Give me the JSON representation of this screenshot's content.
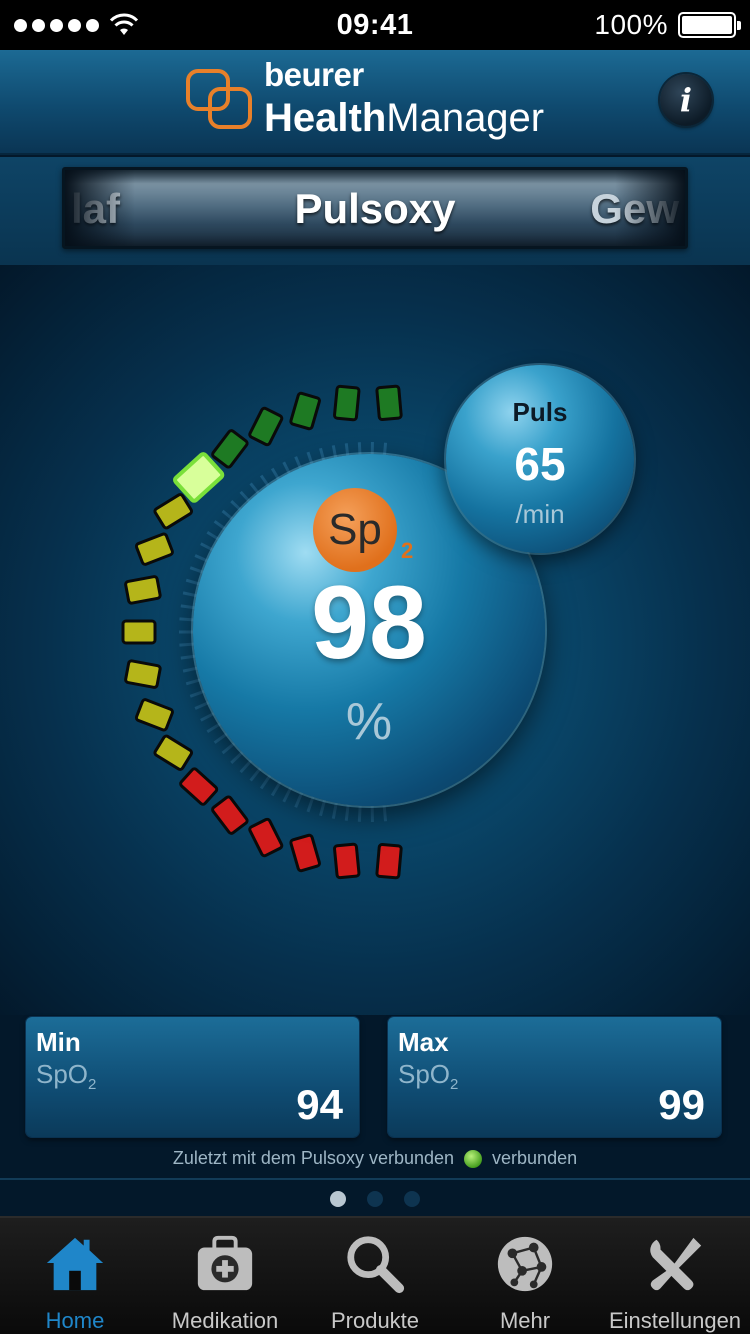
{
  "status_bar": {
    "time": "09:41",
    "battery": "100%",
    "signal_bars": 5
  },
  "header": {
    "brand": "beurer",
    "product_bold": "Health",
    "product_rest": "Manager",
    "info_label": "i",
    "brand_color": "#e8802a"
  },
  "categories": {
    "previous": "laf",
    "current": "Pulsoxy",
    "next": "Gew"
  },
  "gauge": {
    "spo2_symbol": "Sp",
    "spo2_subscript": "2",
    "spo2_value": "98",
    "spo2_unit": "%",
    "indicator_level": 0.29,
    "pulse": {
      "label": "Puls",
      "value": "65",
      "unit": "/min"
    },
    "colors": {
      "red": "#d21c1c",
      "yellow": "#b5b51a",
      "green": "#1e7a23",
      "active": "#d8ff9a"
    }
  },
  "stats": {
    "min": {
      "title": "Min",
      "label": "SpO",
      "label_sub": "2",
      "value": "94"
    },
    "max": {
      "title": "Max",
      "label": "SpO",
      "label_sub": "2",
      "value": "99"
    }
  },
  "connection": {
    "text": "Zuletzt mit dem Pulsoxy verbunden",
    "status": "verbunden",
    "status_color": "#5fbf2a"
  },
  "pagination": {
    "count": 3,
    "active": 1
  },
  "tabs": [
    {
      "label": "Home",
      "icon": "home-icon",
      "active": true
    },
    {
      "label": "Medikation",
      "icon": "medical-kit-icon",
      "active": false
    },
    {
      "label": "Produkte",
      "icon": "magnifier-icon",
      "active": false
    },
    {
      "label": "Mehr",
      "icon": "network-globe-icon",
      "active": false
    },
    {
      "label": "Einstellungen",
      "icon": "tools-icon",
      "active": false
    }
  ]
}
